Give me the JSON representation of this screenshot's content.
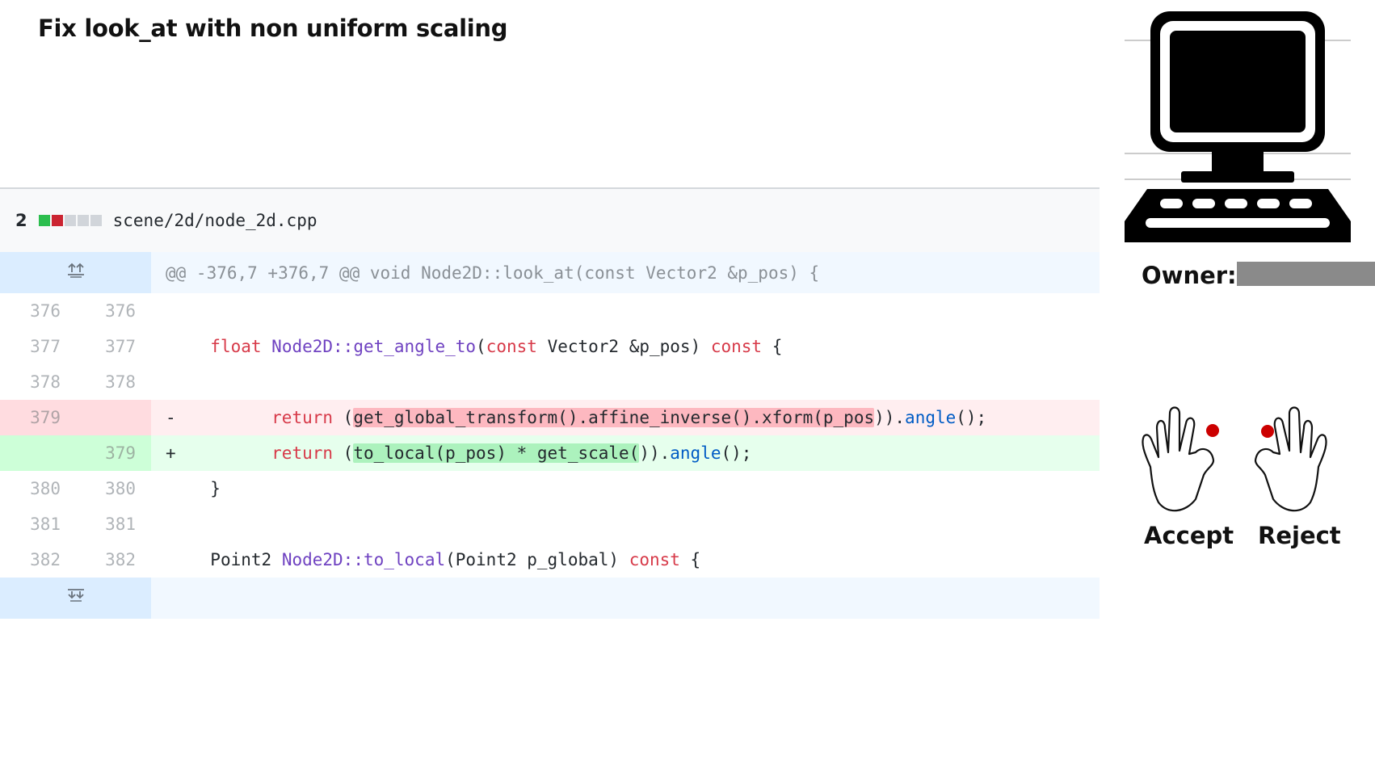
{
  "title": "Fix look_at with non uniform scaling",
  "file": {
    "change_count": "2",
    "path": "scene/2d/node_2d.cpp",
    "diffstat_colors": [
      "#2cbe4e",
      "#cb2431",
      "#d1d5da",
      "#d1d5da",
      "#d1d5da"
    ]
  },
  "hunk_header": "@@ -376,7 +376,7 @@ void Node2D::look_at(const Vector2 &p_pos) {",
  "lines": [
    {
      "old": "376",
      "new": "376",
      "type": "context"
    },
    {
      "old": "377",
      "new": "377",
      "type": "context"
    },
    {
      "old": "378",
      "new": "378",
      "type": "context"
    },
    {
      "old": "379",
      "new": "",
      "type": "del",
      "marker": "-"
    },
    {
      "old": "",
      "new": "379",
      "type": "add",
      "marker": "+"
    },
    {
      "old": "380",
      "new": "380",
      "type": "context"
    },
    {
      "old": "381",
      "new": "381",
      "type": "context"
    },
    {
      "old": "382",
      "new": "382",
      "type": "context"
    }
  ],
  "code": {
    "l377": {
      "t1": "float",
      "t2": " ",
      "t3": "Node2D::get_angle_to",
      "t4": "(",
      "t5": "const",
      "t6": " Vector2 &p_pos) ",
      "t7": "const",
      "t8": " {"
    },
    "l379_del": {
      "t1": "return",
      "t2": " (",
      "t3": "get_global_transform().affine_inverse().xform(p_pos",
      "t4": ")).",
      "t5": "angle",
      "t6": "();"
    },
    "l379_add": {
      "t1": "return",
      "t2": " (",
      "t3": "to_local(p_pos) * get_scale(",
      "t4": ")).",
      "t5": "angle",
      "t6": "();"
    },
    "l380": "}",
    "l382": {
      "t1": "Point2 ",
      "t2": "Node2D::to_local",
      "t3": "(Point2 p_global) ",
      "t4": "const",
      "t5": " {"
    }
  },
  "owner_label": "Owner:",
  "actions": {
    "accept_label": "Accept",
    "reject_label": "Reject"
  },
  "icons": {
    "computer": "computer-icon",
    "left_hand": "left-hand-icon",
    "right_hand": "right-hand-icon",
    "expand_up": "expand-up-icon",
    "expand_down": "expand-down-icon"
  }
}
